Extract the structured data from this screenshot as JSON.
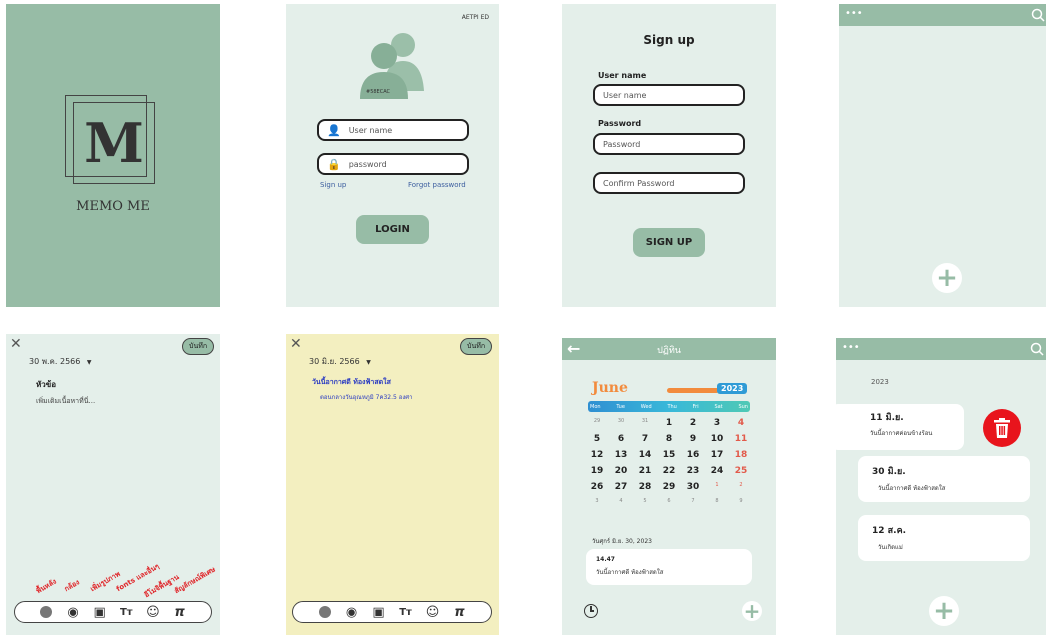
{
  "splash": {
    "logo_letter": "M",
    "app_name": "MEMO ME"
  },
  "login": {
    "top_right": "AETPI ED",
    "avatar_label": "#58ECAC",
    "username_placeholder": "User name",
    "password_placeholder": "password",
    "sign_up_link": "Sign up",
    "forgot_link": "Forgot password",
    "login_button": "LOGIN"
  },
  "signup": {
    "title": "Sign up",
    "username_label": "User name",
    "username_placeholder": "User name",
    "password_label": "Password",
    "password_placeholder": "Password",
    "confirm_placeholder": "Confirm Password",
    "button": "SIGN UP"
  },
  "empty_list": {
    "menu_dots": "•••"
  },
  "editor_blank": {
    "close": "✕",
    "save": "บันทึก",
    "date": "30 พ.ค. 2566",
    "heading": "หัวข้อ",
    "body_placeholder": "เพิ่มเติมเนื้อหาที่นี่...",
    "notes": [
      "พื้นหลัง",
      "กล้อง",
      "เพิ่มรูปภาพ",
      "fonts และอื่นๆ",
      "อีโมจิพื้นฐาน",
      "สัญลักษณ์พิเศษ"
    ]
  },
  "editor_yellow": {
    "close": "✕",
    "save": "บันทึก",
    "date": "30 มิ.ย. 2566",
    "heading": "วันนี้อากาศดี ท้องฟ้าสดใส",
    "body": "ตอนกลางวันอุณหภูมิ 7ค32.5 องศา"
  },
  "calendar": {
    "title": "ปฏิทิน",
    "month": "June",
    "year": "2023",
    "weekdays": [
      "Mon",
      "Tue",
      "Wed",
      "Thu",
      "Fri",
      "Sat",
      "Sun"
    ],
    "weeks": [
      [
        "29",
        "30",
        "31",
        "1",
        "2",
        "3",
        "4"
      ],
      [
        "5",
        "6",
        "7",
        "8",
        "9",
        "10",
        "11"
      ],
      [
        "12",
        "13",
        "14",
        "15",
        "16",
        "17",
        "18"
      ],
      [
        "19",
        "20",
        "21",
        "22",
        "23",
        "24",
        "25"
      ],
      [
        "26",
        "27",
        "28",
        "29",
        "30",
        "1",
        "2"
      ],
      [
        "3",
        "4",
        "5",
        "6",
        "7",
        "8",
        "9"
      ]
    ],
    "selected_date": "วันศุกร์ มิ.ย. 30, 2023",
    "event_time": "14.47",
    "event_text": "วันนี้อากาศดี ท้องฟ้าสดใส"
  },
  "memo_list": {
    "menu_dots": "•••",
    "year": "2023",
    "items": [
      {
        "date": "11 มิ.ย.",
        "text": "วันนี้อากาศค่อนข้างร้อน"
      },
      {
        "date": "30 มิ.ย.",
        "text": "วันนี้อากาศดี ท้องฟ้าสดใส"
      },
      {
        "date": "12 ส.ค.",
        "text": "วันเกิดแม่"
      }
    ]
  },
  "toolbar_icons": [
    "color-circle-icon",
    "camera-icon",
    "image-icon",
    "text-size-icon",
    "emoji-icon",
    "pi-icon"
  ],
  "colors": {
    "sage": "#97bca6",
    "mint": "#e4efea",
    "yellow": "#f3efc0",
    "delete_red": "#e8141c",
    "note_red": "#e0262a"
  }
}
